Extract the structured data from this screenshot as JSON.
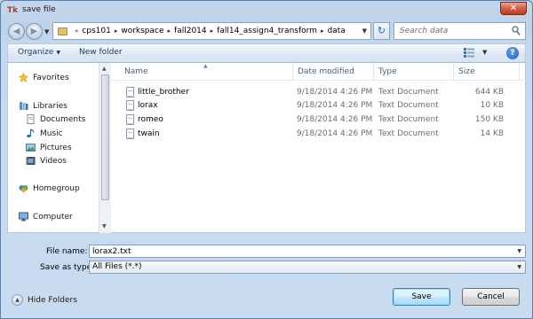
{
  "window": {
    "title": "save file",
    "app_icon_text": "Tk",
    "close_glyph": "✕"
  },
  "address": {
    "crumbs": [
      "cps101",
      "workspace",
      "fall2014",
      "fall14_assign4_transform",
      "data"
    ],
    "search_placeholder": "Search data"
  },
  "toolbar": {
    "organize_label": "Organize",
    "new_folder_label": "New folder",
    "help_glyph": "?"
  },
  "sidebar": {
    "favorites": "Favorites",
    "libraries": "Libraries",
    "documents": "Documents",
    "music": "Music",
    "pictures": "Pictures",
    "videos": "Videos",
    "homegroup": "Homegroup",
    "computer": "Computer"
  },
  "columns": {
    "name": "Name",
    "date": "Date modified",
    "type": "Type",
    "size": "Size"
  },
  "files": [
    {
      "name": "little_brother",
      "date": "9/18/2014 4:26 PM",
      "type": "Text Document",
      "size": "644 KB"
    },
    {
      "name": "lorax",
      "date": "9/18/2014 4:26 PM",
      "type": "Text Document",
      "size": "10 KB"
    },
    {
      "name": "romeo",
      "date": "9/18/2014 4:26 PM",
      "type": "Text Document",
      "size": "150 KB"
    },
    {
      "name": "twain",
      "date": "9/18/2014 4:26 PM",
      "type": "Text Document",
      "size": "14 KB"
    }
  ],
  "form": {
    "file_name_label": "File name:",
    "file_name_value": "lorax2.txt",
    "save_as_type_label": "Save as type:",
    "save_as_type_value": "All Files (*.*)"
  },
  "footer": {
    "hide_folders_label": "Hide Folders",
    "save_label": "Save",
    "cancel_label": "Cancel"
  }
}
